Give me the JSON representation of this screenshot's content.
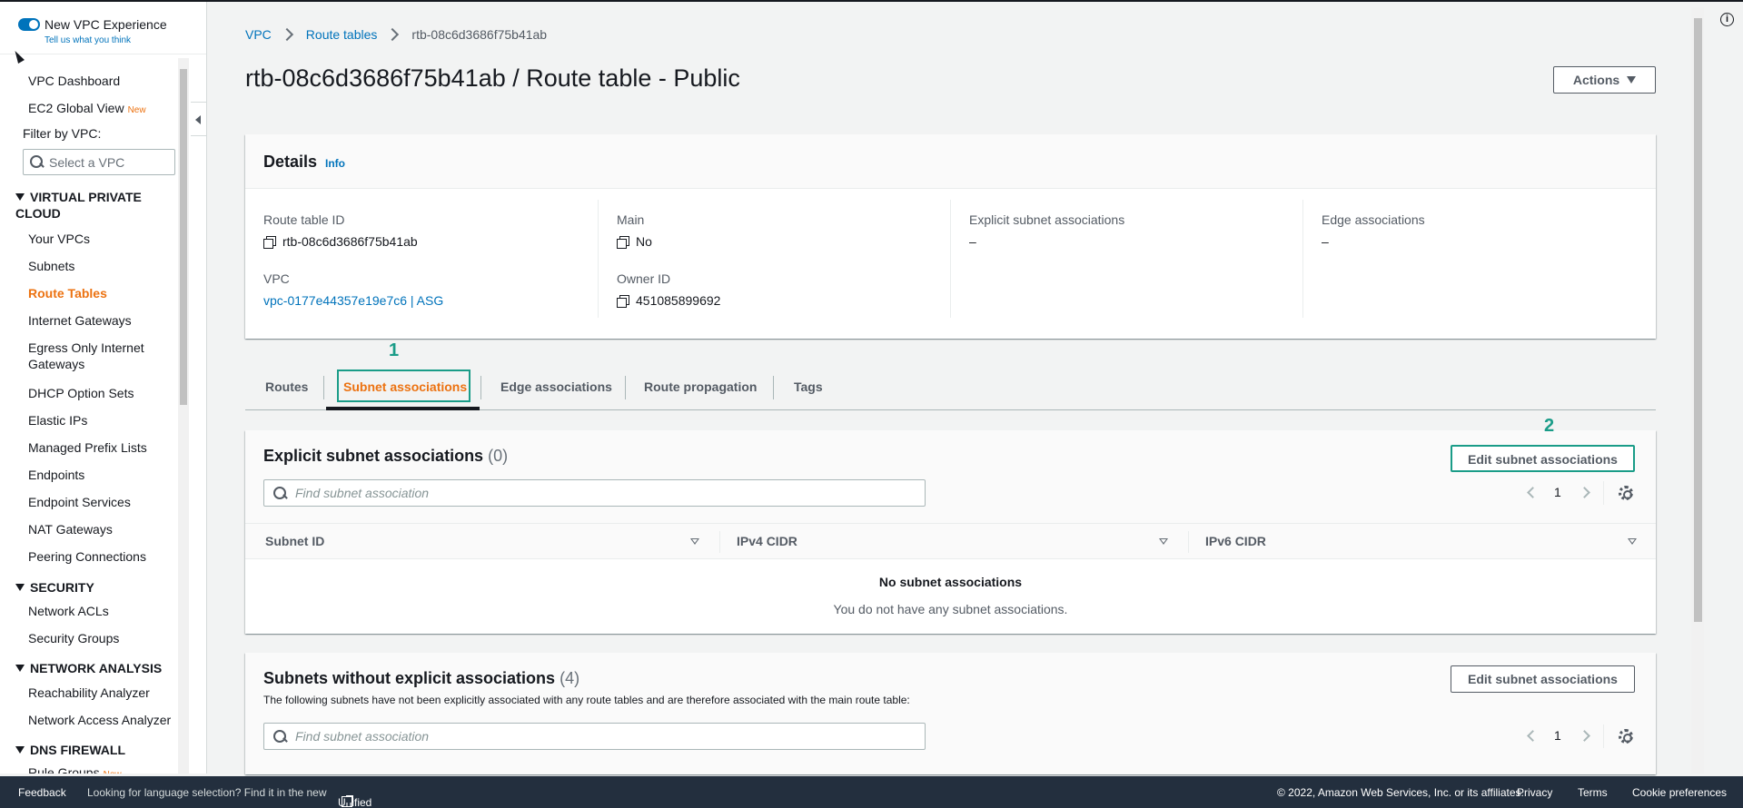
{
  "sidebar": {
    "experience_title": "New VPC Experience",
    "experience_link": "Tell us what you think",
    "experience_enabled": true,
    "items": {
      "dashboard": "VPC Dashboard",
      "ec2_global_view": "EC2 Global View",
      "new_badge": "New",
      "filter_label": "Filter by VPC:",
      "vpc_select_placeholder": "Select a VPC",
      "section_vpc": "VIRTUAL PRIVATE CLOUD",
      "your_vpcs": "Your VPCs",
      "subnets": "Subnets",
      "route_tables": "Route Tables",
      "internet_gateways": "Internet Gateways",
      "egress_only": "Egress Only Internet Gateways",
      "dhcp": "DHCP Option Sets",
      "elastic_ips": "Elastic IPs",
      "prefix_lists": "Managed Prefix Lists",
      "endpoints": "Endpoints",
      "endpoint_services": "Endpoint Services",
      "nat": "NAT Gateways",
      "peering": "Peering Connections",
      "section_security": "SECURITY",
      "network_acls": "Network ACLs",
      "security_groups": "Security Groups",
      "section_network_analysis": "NETWORK ANALYSIS",
      "reachability": "Reachability Analyzer",
      "network_access": "Network Access Analyzer",
      "section_dns_firewall": "DNS FIREWALL",
      "rule_groups": "Rule Groups"
    }
  },
  "breadcrumb": {
    "vpc": "VPC",
    "route_tables": "Route tables",
    "current": "rtb-08c6d3686f75b41ab"
  },
  "page": {
    "title": "rtb-08c6d3686f75b41ab / Route table - Public",
    "actions_label": "Actions"
  },
  "details": {
    "title": "Details",
    "info": "Info",
    "route_table_id_label": "Route table ID",
    "route_table_id": "rtb-08c6d3686f75b41ab",
    "main_label": "Main",
    "main": "No",
    "explicit_label": "Explicit subnet associations",
    "explicit": "–",
    "edge_label": "Edge associations",
    "edge": "–",
    "vpc_label": "VPC",
    "vpc": "vpc-0177e44357e19e7c6 | ASG",
    "owner_label": "Owner ID",
    "owner": "451085899692"
  },
  "tabs": {
    "routes": "Routes",
    "subnet_associations": "Subnet associations",
    "edge_associations": "Edge associations",
    "route_propagation": "Route propagation",
    "tags": "Tags",
    "active": "subnet_associations"
  },
  "annotations": {
    "step1": "1",
    "step2": "2",
    "color": "#1a9c88"
  },
  "explicit_panel": {
    "title": "Explicit subnet associations",
    "count": "(0)",
    "edit_label": "Edit subnet associations",
    "search_placeholder": "Find subnet association",
    "page": "1",
    "columns": [
      "Subnet ID",
      "IPv4 CIDR",
      "IPv6 CIDR"
    ],
    "empty_title": "No subnet associations",
    "empty_desc": "You do not have any subnet associations."
  },
  "implicit_panel": {
    "title": "Subnets without explicit associations",
    "count": "(4)",
    "description": "The following subnets have not been explicitly associated with any route tables and are therefore associated with the main route table:",
    "edit_label": "Edit subnet associations",
    "search_placeholder": "Find subnet association",
    "page": "1"
  },
  "footer": {
    "feedback": "Feedback",
    "language_msg": "Looking for language selection? Find it in the new",
    "unified_settings": "Unified Settings",
    "copyright": "© 2022, Amazon Web Services, Inc. or its affiliates.",
    "privacy": "Privacy",
    "terms": "Terms",
    "cookies": "Cookie preferences"
  },
  "colors": {
    "link": "#0073bb",
    "active_orange": "#ec7211",
    "footer_bg": "#232f3e"
  }
}
